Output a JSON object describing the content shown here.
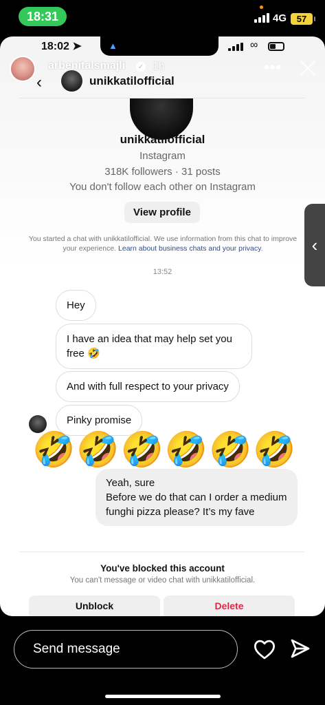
{
  "status_bar": {
    "time": "18:31",
    "network": "4G",
    "battery": "57"
  },
  "inner_status": {
    "time": "18:02"
  },
  "story": {
    "username": "arbenitalsmajli",
    "age": "1h",
    "icons": [
      "verified-icon",
      "more-icon",
      "close-icon"
    ]
  },
  "chat": {
    "title": "unikkatilofficial",
    "profile": {
      "name": "unikkatilofficial",
      "platform": "Instagram",
      "stats": "318K followers · 31 posts",
      "follow_status": "You don't follow each other on Instagram",
      "view_profile_label": "View profile"
    },
    "disclaimer_text": "You started a chat with unikkatilofficial. We use information from this chat to improve your experience.",
    "disclaimer_link": "Learn about business chats and your privacy",
    "timestamp": "13:52",
    "messages_in": [
      "Hey",
      "I have an idea that may help set you free 🤣",
      "And with full respect to your privacy",
      "Pinky promise"
    ],
    "emoji_row": "🤣🤣🤣🤣🤣🤣",
    "message_out": {
      "line1": "Yeah, sure",
      "line2": "Before we do that can I order a medium funghi pizza  please? It’s my fave"
    },
    "blocked": {
      "title": "You've blocked this account",
      "subtitle": "You can't message or video chat with unikkatilofficial.",
      "unblock_label": "Unblock",
      "delete_label": "Delete"
    }
  },
  "reply_bar": {
    "placeholder": "Send message"
  },
  "colors": {
    "time_pill": "#34c759",
    "battery": "#f3d23d",
    "delete": "#e0264b",
    "link": "#2b4a8a"
  }
}
